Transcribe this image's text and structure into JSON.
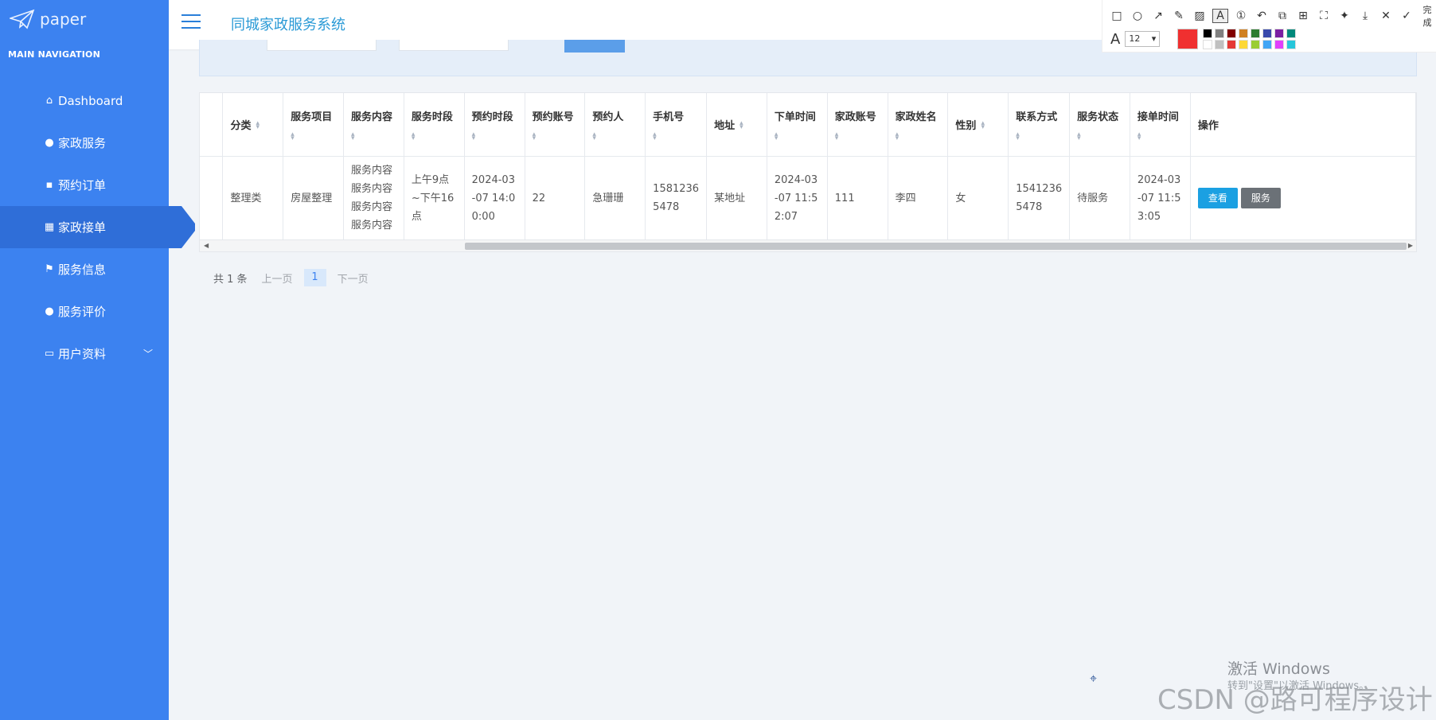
{
  "sidebar": {
    "logo": "paper",
    "nav_heading": "MAIN NAVIGATION",
    "items": [
      {
        "label": "Dashboard",
        "icon": "home-icon"
      },
      {
        "label": "家政服务",
        "icon": "user-icon"
      },
      {
        "label": "预约订单",
        "icon": "chart-icon"
      },
      {
        "label": "家政接单",
        "icon": "grid-icon"
      },
      {
        "label": "服务信息",
        "icon": "flag-icon"
      },
      {
        "label": "服务评价",
        "icon": "pin-icon"
      },
      {
        "label": "用户资料",
        "icon": "card-icon"
      }
    ]
  },
  "header": {
    "title": "同城家政服务系统"
  },
  "table": {
    "columns": [
      "分类",
      "服务项目",
      "服务内容",
      "服务时段",
      "预约时段",
      "预约账号",
      "预约人",
      "手机号",
      "地址",
      "下单时间",
      "家政账号",
      "家政姓名",
      "性别",
      "联系方式",
      "服务状态",
      "接单时间",
      "操作"
    ],
    "row": {
      "category": "整理类",
      "item": "房屋整理",
      "content": "服务内容\n服务内容\n服务内容\n服务内容",
      "period": "上午9点\n~下午16\n点",
      "appt_time": "2024-03\n-07 14:0\n0:00",
      "appt_account": "22",
      "appt_person": "急珊珊",
      "phone": "1581236\n5478",
      "address": "某地址",
      "order_time": "2024-03\n-07 11:5\n2:07",
      "hk_account": "111",
      "hk_name": "李四",
      "gender": "女",
      "contact": "1541236\n5478",
      "status": "待服务",
      "accept_time": "2024-03\n-07 11:5\n3:05",
      "view_btn": "查看",
      "serve_btn": "服务"
    }
  },
  "pagination": {
    "total": "共 1 条",
    "prev": "上一页",
    "page": "1",
    "next": "下一页"
  },
  "snip_toolbar": {
    "done": "完成",
    "font_size": "12",
    "current_color": "#f03030",
    "palette": [
      "#000000",
      "#808080",
      "#800000",
      "#d08020",
      "#2e7d32",
      "#3949ab",
      "#7b1fa2",
      "#00897b",
      "#ffffff",
      "#c0c0c0",
      "#e53935",
      "#fdd835",
      "#9acd32",
      "#42a5f5",
      "#e040fb",
      "#26c6da"
    ]
  },
  "watermark": {
    "windows": "激活 Windows",
    "windows_sub": "转到\"设置\"以激活 Windows。",
    "csdn": "CSDN @路可程序设计"
  }
}
